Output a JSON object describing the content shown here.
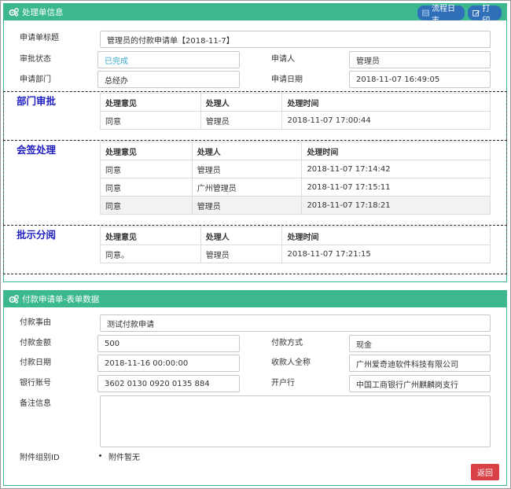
{
  "header1": {
    "title": "处理单信息",
    "log_button": "流程日志",
    "print_button": "打印"
  },
  "form1": {
    "title_label": "申请单标题",
    "title_value": "管理员的付款申请单【2018-11-7】",
    "status_label": "审批状态",
    "status_value": "已完成",
    "applicant_label": "申请人",
    "applicant_value": "管理员",
    "dept_label": "申请部门",
    "dept_value": "总经办",
    "date_label": "申请日期",
    "date_value": "2018-11-07 16:49:05"
  },
  "sections": [
    {
      "title": "部门审批",
      "columns": [
        "处理意见",
        "处理人",
        "处理时间"
      ],
      "rows": [
        [
          "同意",
          "管理员",
          "2018-11-07 17:00:44"
        ]
      ]
    },
    {
      "title": "会签处理",
      "columns": [
        "处理意见",
        "处理人",
        "处理时间"
      ],
      "rows": [
        [
          "同意",
          "管理员",
          "2018-11-07 17:14:42"
        ],
        [
          "同意",
          "广州管理员",
          "2018-11-07 17:15:11"
        ],
        [
          "同意",
          "管理员",
          "2018-11-07 17:18:21"
        ]
      ]
    },
    {
      "title": "批示分阅",
      "columns": [
        "处理意见",
        "处理人",
        "处理时间"
      ],
      "rows": [
        [
          "同意。",
          "管理员",
          "2018-11-07 17:21:15"
        ]
      ]
    }
  ],
  "header2": {
    "title": "付款申请单-表单数据"
  },
  "form2": {
    "reason_label": "付款事由",
    "reason_value": "测试付款申请",
    "amount_label": "付款金额",
    "amount_value": "500",
    "method_label": "付款方式",
    "method_value": "现金",
    "paydate_label": "付款日期",
    "paydate_value": "2018-11-16 00:00:00",
    "payee_label": "收款人全称",
    "payee_value": "广州爱奇迪软件科技有限公司",
    "account_label": "银行账号",
    "account_value": "3602 0130 0920 0135 884",
    "bank_label": "开户行",
    "bank_value": "中国工商银行广州麒麟岗支行",
    "remark_label": "备注信息",
    "remark_value": "",
    "attach_label": "附件组别ID",
    "attach_value": "附件暂无"
  },
  "return_button": "返回",
  "colors": {
    "header_green": "#3cb890",
    "button_blue": "#2e6fb8",
    "section_title": "#1f1fc0",
    "status_text": "#3aa7c8",
    "return_red": "#d94147"
  }
}
